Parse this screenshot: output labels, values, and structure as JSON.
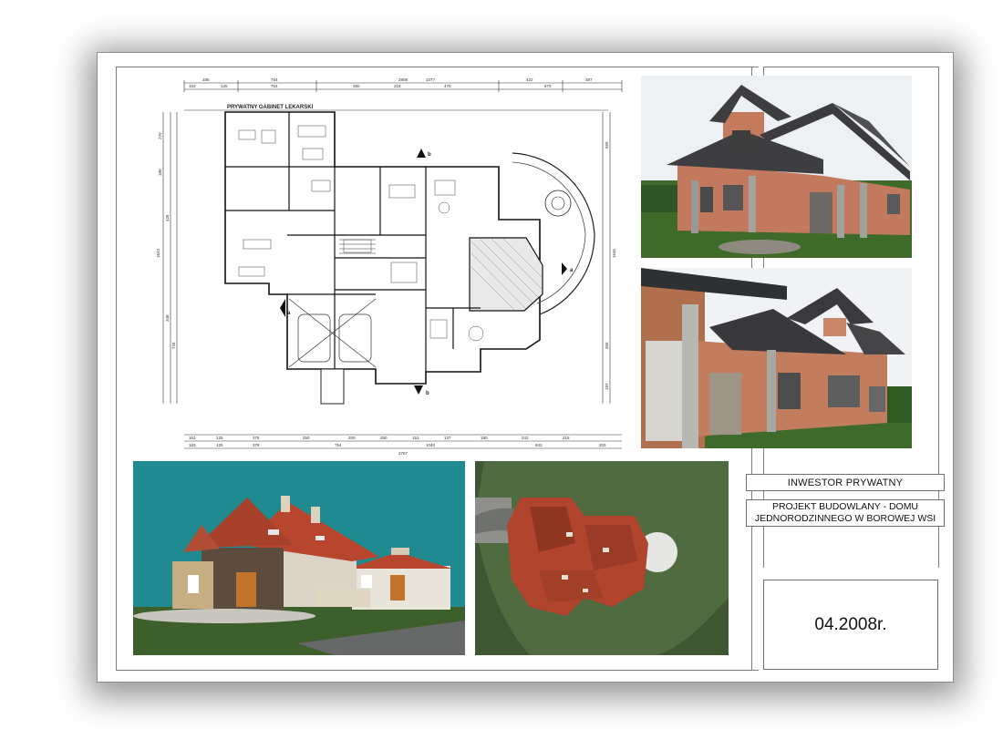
{
  "plan": {
    "room_label": "PRYWATNY GABINET LEKARSKI",
    "top_dims_row1": [
      "286",
      "754",
      "2808",
      "1077",
      "422",
      "387"
    ],
    "top_dims_row2": [
      "163",
      "125",
      "754",
      "360",
      "218",
      "470",
      "870"
    ],
    "bottom_dims_row1": [
      "163",
      "125",
      "378",
      "250",
      "200",
      "250",
      "151",
      "137",
      "180",
      "242",
      "218"
    ],
    "bottom_dims_row2": [
      "163",
      "125",
      "378",
      "754",
      "1040",
      "842",
      "203"
    ],
    "total_bottom": "2787",
    "left_dims": [
      "270",
      "180",
      "426",
      "1643",
      "348",
      "726"
    ],
    "right_dims": [
      "569",
      "1645",
      "365",
      "187"
    ],
    "section_marks": [
      "a",
      "a",
      "b",
      "b"
    ]
  },
  "title_block": {
    "investor": "INWESTOR PRYWATNY",
    "project_line1": "PROJEKT BUDOWLANY - DOMU",
    "project_line2": "JEDNORODZINNEGO W BOROWEJ WSI",
    "date": "04.2008r."
  },
  "colors": {
    "render_sky": "#1f8a90",
    "roof_red": "#b8452e",
    "brick": "#c0775a",
    "grass": "#3d5f2c",
    "site_green": "#516b41",
    "shadow": "#000000"
  }
}
